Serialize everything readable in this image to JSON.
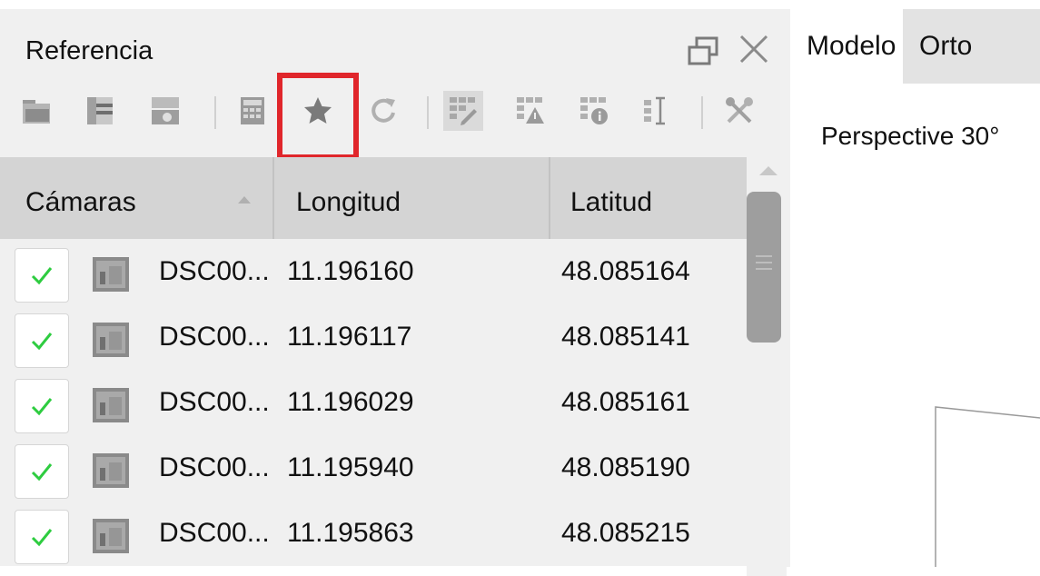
{
  "panel": {
    "title": "Referencia",
    "float_icon": "window-float-icon",
    "close_icon": "close-icon"
  },
  "toolbar": {
    "buttons": [
      {
        "name": "import-folder-icon",
        "state": "disabled"
      },
      {
        "name": "import-file-icon",
        "state": "disabled"
      },
      {
        "name": "import-exif-icon",
        "state": "disabled"
      },
      {
        "name": "calculator-icon",
        "state": "disabled"
      },
      {
        "name": "star-icon",
        "state": "highlighted"
      },
      {
        "name": "refresh-icon",
        "state": "disabled"
      },
      {
        "name": "grid-edit-icon",
        "state": "pressed"
      },
      {
        "name": "grid-warning-icon",
        "state": "disabled"
      },
      {
        "name": "grid-info-icon",
        "state": "disabled"
      },
      {
        "name": "text-cursor-icon",
        "state": "disabled"
      },
      {
        "name": "settings-tools-icon",
        "state": "disabled"
      }
    ],
    "highlight_color": "#e0262b"
  },
  "table": {
    "headers": {
      "camera": "Cámaras",
      "longitude": "Longitud",
      "latitude": "Latitud"
    },
    "sort_icon": "sort-ascending-icon",
    "rows": [
      {
        "checked": true,
        "name": "DSC00...",
        "longitude": "11.196160",
        "latitude": "48.085164"
      },
      {
        "checked": true,
        "name": "DSC00...",
        "longitude": "11.196117",
        "latitude": "48.085141"
      },
      {
        "checked": true,
        "name": "DSC00...",
        "longitude": "11.196029",
        "latitude": "48.085161"
      },
      {
        "checked": true,
        "name": "DSC00...",
        "longitude": "11.195940",
        "latitude": "48.085190"
      },
      {
        "checked": true,
        "name": "DSC00...",
        "longitude": "11.195863",
        "latitude": "48.085215"
      }
    ],
    "check_color": "#2ecc40",
    "row_icon": "image-icon"
  },
  "view": {
    "tabs": {
      "model": "Modelo",
      "ortho": "Orto"
    },
    "projection_label": "Perspective 30°"
  }
}
